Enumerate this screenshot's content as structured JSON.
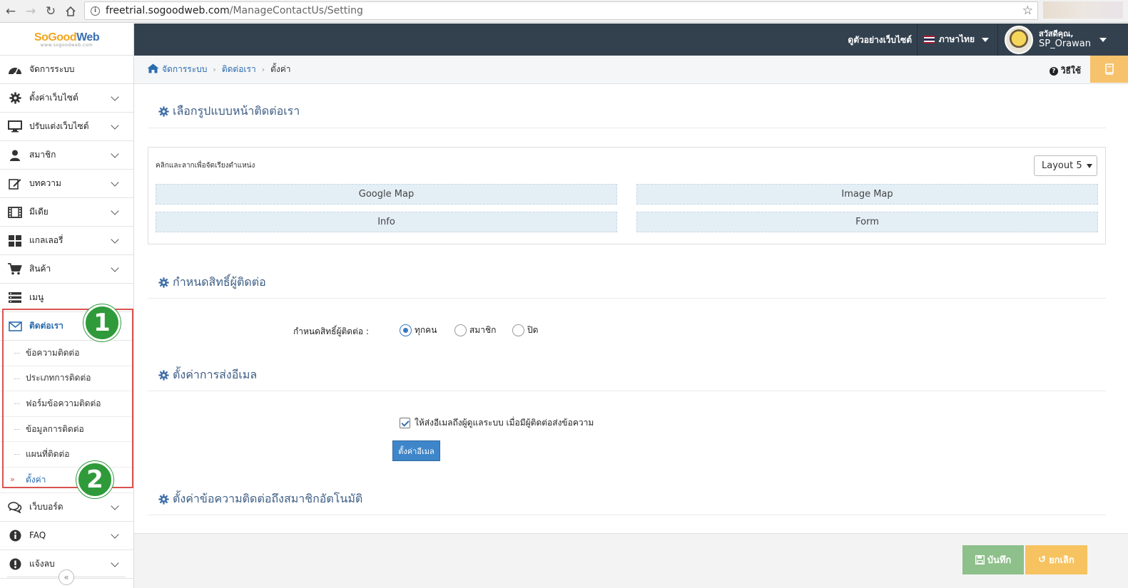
{
  "browser": {
    "url_host": "freetrial.sogoodweb.com",
    "url_path": "/ManageContactUs/Setting"
  },
  "logo": {
    "text_a": "SoGood",
    "text_b": "Web",
    "sub": "www.sogoodweb.com"
  },
  "sidebar": {
    "items": [
      {
        "label": "จัดการระบบ",
        "icon": "dashboard-icon"
      },
      {
        "label": "ตั้งค่าเว็บไซต์",
        "icon": "gear-icon"
      },
      {
        "label": "ปรับแต่งเว็บไซต์",
        "icon": "monitor-icon"
      },
      {
        "label": "สมาชิก",
        "icon": "user-icon"
      },
      {
        "label": "บทความ",
        "icon": "edit-icon"
      },
      {
        "label": "มีเดีย",
        "icon": "film-icon"
      },
      {
        "label": "แกลเลอรี่",
        "icon": "grid-icon"
      },
      {
        "label": "สินค้า",
        "icon": "cart-icon"
      },
      {
        "label": "เมนู",
        "icon": "menu-icon"
      },
      {
        "label": "ติดต่อเรา",
        "icon": "envelope-icon"
      },
      {
        "label": "เว็บบอร์ด",
        "icon": "comments-icon"
      },
      {
        "label": "FAQ",
        "icon": "info-icon"
      },
      {
        "label": "แจ้งลบ",
        "icon": "exclamation-icon"
      }
    ],
    "submenu": [
      "ข้อความติดต่อ",
      "ประเภทการติดต่อ",
      "ฟอร์มข้อความติดต่อ",
      "ข้อมูลการติดต่อ",
      "แผนที่ติดต่อ",
      "ตั้งค่า"
    ],
    "badge_1": "1",
    "badge_2": "2"
  },
  "topbar": {
    "view_site": "ดูตัวอย่างเว็บไซต์",
    "language": "ภาษาไทย",
    "greeting": "สวัสดีคุณ,",
    "username": "SP_Orawan"
  },
  "breadcrumb": {
    "home": "จัดการระบบ",
    "parent": "ติดต่อเรา",
    "current": "ตั้งค่า",
    "howto": "วิธีใช้"
  },
  "sections": {
    "layout_title": "เลือกรูปแบบหน้าติดต่อเรา",
    "layout_hint": "คลิกและลากเพื่อจัดเรียงตำแหน่ง",
    "layout_selected": "Layout 5",
    "blocks": [
      "Google Map",
      "Image Map",
      "Info",
      "Form"
    ],
    "perm_title": "กำหนดสิทธิ์ผู้ติดต่อ",
    "perm_label": "กำหนดสิทธิ์ผู้ติดต่อ :",
    "perm_options": [
      "ทุกคน",
      "สมาชิก",
      "ปิด"
    ],
    "perm_selected": "ทุกคน",
    "email_title": "ตั้งค่าการส่งอีเมล",
    "email_checkbox": "ให้ส่งอีเมลถึงผู้ดูแลระบบ เมื่อมีผู้ติดต่อส่งข้อความ",
    "email_checked": true,
    "email_button": "ตั้งค่าอีเมล",
    "auto_title": "ตั้งค่าข้อความติดต่อถึงสมาชิกอัตโนมัติ"
  },
  "footer": {
    "save": "บันทึก",
    "cancel": "ยกเลิก"
  },
  "colors": {
    "topbar": "#33414f",
    "accent": "#2b6cb0",
    "save": "#8dc08a",
    "cancel": "#f6c360",
    "highlight": "#d9534f",
    "badge": "#2f9a3a"
  }
}
